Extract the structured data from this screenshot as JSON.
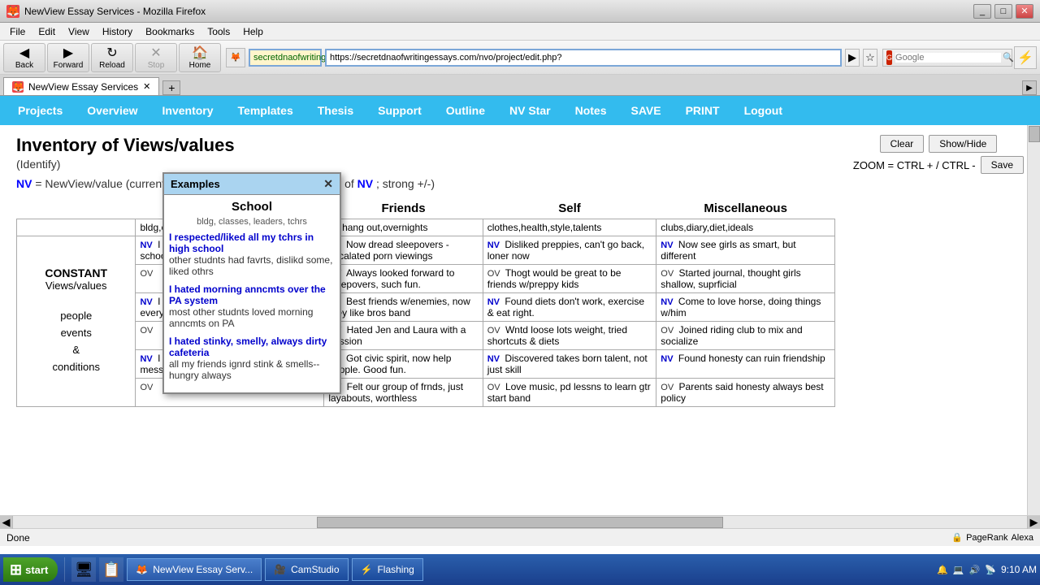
{
  "titleBar": {
    "title": "NewView Essay Services - Mozilla Firefox",
    "icon": "🦊",
    "controls": [
      "_",
      "□",
      "✕"
    ]
  },
  "menuBar": {
    "items": [
      "File",
      "Edit",
      "View",
      "History",
      "Bookmarks",
      "Tools",
      "Help"
    ]
  },
  "toolbar": {
    "back": "Back",
    "forward": "Forward",
    "reload": "Reload",
    "stop": "Stop",
    "home": "Home",
    "addressUrl": "https://secretdnaofwritingessays.com/nvo/project/edit.php?",
    "addressDisplay": "secretdnaofwritingessays.com",
    "searchPlaceholder": "Google",
    "searchEngine": "Google"
  },
  "tab": {
    "label": "NewView Essay Services",
    "favicon": "🦊"
  },
  "navMenu": {
    "items": [
      "Projects",
      "Overview",
      "Inventory",
      "Templates",
      "Thesis",
      "Support",
      "Outline",
      "NV Star",
      "Notes",
      "SAVE",
      "PRINT",
      "Logout"
    ]
  },
  "page": {
    "title": "Inventory of Views/values",
    "subtitle": "(Identify)",
    "zoomText": "ZOOM = CTRL + / CTRL -",
    "clearBtn": "Clear",
    "showHideBtn": "Show/Hide",
    "saveBtn": "Save",
    "nvDefinition": "NV = NewView/value (current OV); OV = OldView/value (reverse of NV; strong +/-)"
  },
  "columns": {
    "school": {
      "title": "School",
      "subheader": "bldg,classes,leaders,tchrs",
      "rows": [
        {
          "nv": "I really liked my last Engl tchr in hi school",
          "ov": ""
        },
        {
          "nv": "I liked the patriotic flag ceremony every day",
          "ov": ""
        },
        {
          "nv": "I hated the dirty, smelly, always messy bathrooms",
          "ov": ""
        }
      ]
    },
    "friends": {
      "title": "Friends",
      "subheader": "un,hang out,overnights",
      "rows": [
        {
          "nv": "Now dread sleepovers - escalated porn viewings",
          "ov": "Always looked forward to sleepovers, such fun."
        },
        {
          "nv": "Best friends w/enemies, now they like bros band",
          "ov": "Hated Jen and Laura with a passion"
        },
        {
          "nv": "Got civic spirit, now help people. Good fun.",
          "ov": "Felt our group of frnds, just layabouts, worthless"
        }
      ]
    },
    "self": {
      "title": "Self",
      "subheader": "clothes,health,style,talents",
      "rows": [
        {
          "nv": "Disliked preppies, can't go back, loner now",
          "ov": "Thogt would be great to be friends w/preppy kids"
        },
        {
          "nv": "Found diets don't work, exercise & eat right.",
          "ov": "Wntd loose lots weight, tried shortcuts & diets"
        },
        {
          "nv": "Discovered takes born talent, not just skill",
          "ov": "Love music, pd lessns to learn gtr start band"
        }
      ]
    },
    "miscellaneous": {
      "title": "Miscellaneous",
      "subheader": "clubs,diary,diet,ideals",
      "rows": [
        {
          "nv": "Now see girls as smart, but different",
          "ov": "Started journal, thought girls shallow, suprficial"
        },
        {
          "nv": "Come to love horse, doing things w/him",
          "ov": "Joined riding club to mix and socialize"
        },
        {
          "nv": "Found honesty can ruin friendship",
          "ov": "Parents said honesty always best policy"
        }
      ]
    }
  },
  "leftPanel": {
    "constantTitle": "CONSTANT",
    "constantSub": "Views/values",
    "peopleEvents": "people\nevents\n&\nconditions"
  },
  "examplesPopup": {
    "title": "Examples",
    "closeBtn": "✕",
    "columnTitle": "School",
    "subheader": "bldg, classes, leaders, tchrs",
    "entries": [
      {
        "nv": "I respected/liked all my tchrs in high school",
        "ov": "other studnts had favrts, dislikd some, liked othrs"
      },
      {
        "nv": "I hated morning anncmts over the PA system",
        "ov": "most other studnts loved morning anncmts on PA"
      },
      {
        "nv": "I hated stinky, smelly, always dirty cafeteria",
        "ov": "all my friends ignrd stink & smells--hungry always"
      }
    ]
  },
  "statusBar": {
    "text": "Done",
    "rightItems": [
      "PageRank",
      "Alexa"
    ]
  },
  "taskbar": {
    "startBtn": "start",
    "items": [
      "NewView Essay Serv...",
      "CamStudio",
      "Flashing"
    ],
    "time": "9:10 AM"
  }
}
